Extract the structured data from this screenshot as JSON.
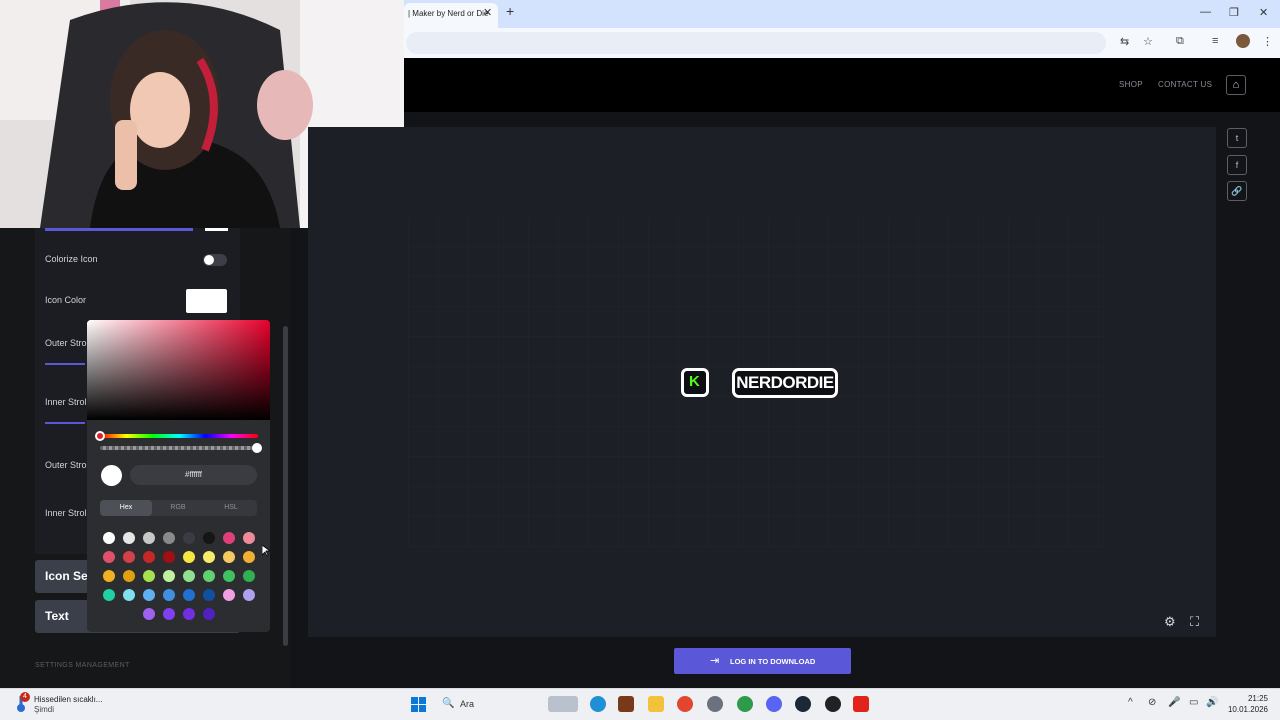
{
  "browser": {
    "tab_title": "| Maker by Nerd or Die",
    "tab_close": "✕",
    "new_tab": "+",
    "window_controls": [
      "—",
      "❐",
      "✕"
    ]
  },
  "site_nav": {
    "links": [
      "SHOP",
      "CONTACT US"
    ],
    "home_icon": "⌂"
  },
  "left_panel": {
    "colorize_icon_label": "Colorize Icon",
    "icon_color_label": "Icon Color",
    "outer_stroke_label_1": "Outer Stro",
    "inner_stroke_label_1": "Inner Strol",
    "outer_stroke_label_2": "Outer Stro",
    "inner_stroke_label_2": "Inner Strol",
    "sections": [
      "Icon Se",
      "Text"
    ],
    "settings_management": "SETTINGS MANAGEMENT",
    "icon_color_value": "#ffffff",
    "colorize_icon_enabled": false
  },
  "color_picker": {
    "hex_value": "#ffffff",
    "hue": "#ff0000",
    "modes": [
      "Hex",
      "RGB",
      "HSL"
    ],
    "active_mode": "Hex",
    "palette": [
      [
        "#ffffff",
        "#e6e6e6",
        "#c8c8c8",
        "#8a8a8a",
        "#3b3b44",
        "#151515",
        "#e0407a",
        "#f08a9a"
      ],
      [
        "#e0506a",
        "#d4404a",
        "#c62828",
        "#a01010",
        "#f5e642",
        "#f7ec6a",
        "#f5c860",
        "#f0b030"
      ],
      [
        "#f0b020",
        "#e0a010",
        "#a8e050",
        "#c0f0a0",
        "#90e090",
        "#60d070",
        "#40c060",
        "#30b050"
      ],
      [
        "#20d0a0",
        "#80e0f0",
        "#60b0f0",
        "#4090e0",
        "#2070d0",
        "#1050a0",
        "#f0a0e0",
        "#b0a0f0"
      ],
      [
        "#a060f0",
        "#8040f0",
        "#7030e0",
        "#5020c0"
      ]
    ]
  },
  "preview": {
    "logo_badge_letter": "K",
    "logo_text": "NERDORDIE",
    "kick_green": "#53fc18",
    "accent": "#5b57d9",
    "settings_icon": "⚙",
    "fullscreen_icon": "⛶",
    "social_icons": [
      "t",
      "f",
      "🔗"
    ],
    "download_label": "LOG IN TO DOWNLOAD",
    "download_icon": "⇥"
  },
  "taskbar": {
    "notification_count": "4",
    "weather_title": "Hissedilen sıcaklı...",
    "weather_sub": "Şimdi",
    "search_label": "Ara",
    "search_icon": "🔍",
    "time": "21:25",
    "date": "10.01.2026",
    "tray_icons": [
      "^",
      "⊘",
      "🎤",
      "▭",
      "🔊"
    ]
  }
}
